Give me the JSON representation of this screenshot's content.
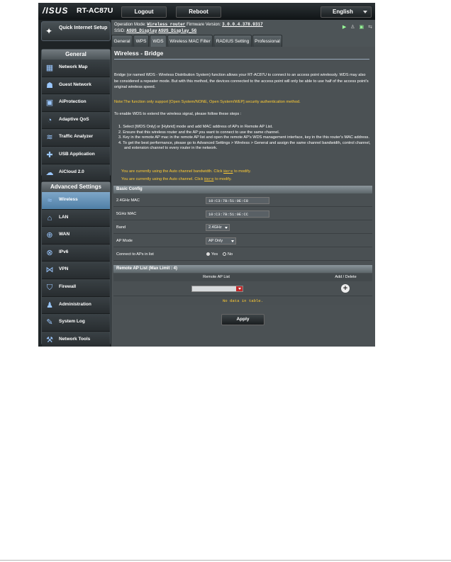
{
  "header": {
    "brand": "/ISUS",
    "model": "RT-AC87U",
    "logout": "Logout",
    "reboot": "Reboot",
    "language": "English"
  },
  "status": {
    "op_mode_label": "Operation Mode:",
    "op_mode": "Wireless router",
    "fw_label": "Firmware Version:",
    "fw": "3.0.0.4.378.9317",
    "ssid_label": "SSID:",
    "ssid_1": "ASUS_Display",
    "ssid_2": "ASUS_Display_5G"
  },
  "sidebar": {
    "quick_setup": "Quick Internet Setup",
    "general_title": "General",
    "general_items": [
      {
        "label": "Network Map",
        "icon": "network-map-icon",
        "glyph": "▦"
      },
      {
        "label": "Guest Network",
        "icon": "guest-network-icon",
        "glyph": "☗"
      },
      {
        "label": "AiProtection",
        "icon": "lock-icon",
        "glyph": "▣"
      },
      {
        "label": "Adaptive QoS",
        "icon": "gauge-icon",
        "glyph": "◔"
      },
      {
        "label": "Traffic Analyzer",
        "icon": "chart-icon",
        "glyph": "≋"
      },
      {
        "label": "USB Application",
        "icon": "puzzle-icon",
        "glyph": "✚"
      },
      {
        "label": "AiCloud 2.0",
        "icon": "cloud-icon",
        "glyph": "☁"
      }
    ],
    "advanced_title": "Advanced Settings",
    "advanced_items": [
      {
        "label": "Wireless",
        "icon": "wireless-icon",
        "glyph": "≈",
        "active": true
      },
      {
        "label": "LAN",
        "icon": "house-icon",
        "glyph": "⌂"
      },
      {
        "label": "WAN",
        "icon": "globe-icon",
        "glyph": "⊕"
      },
      {
        "label": "IPv6",
        "icon": "ipv6-icon",
        "glyph": "⊗"
      },
      {
        "label": "VPN",
        "icon": "vpn-icon",
        "glyph": "⋈"
      },
      {
        "label": "Firewall",
        "icon": "shield-icon",
        "glyph": "⛉"
      },
      {
        "label": "Administration",
        "icon": "admin-icon",
        "glyph": "♟"
      },
      {
        "label": "System Log",
        "icon": "log-icon",
        "glyph": "✎"
      },
      {
        "label": "Network Tools",
        "icon": "tools-icon",
        "glyph": "⚒"
      }
    ]
  },
  "tabs": [
    "General",
    "WPS",
    "WDS",
    "Wireless MAC Filter",
    "RADIUS Setting",
    "Professional"
  ],
  "page": {
    "title": "Wireless - Bridge",
    "intro": "Bridge (or named WDS - Wireless Distribution System) function allows your RT-AC87U to connect to an access point wirelessly. WDS may also be considered a repeater mode. But with this method, the devices connected to the access point will only be able to use half of the access point's original wireless speed.",
    "note": "Note:The function only support [Open System/NONE, Open System/WEP] security authentication method.",
    "enable": "To enable WDS to extend the wireless signal, please follow these steps :",
    "steps": [
      "1.  Select [WDS Only] or [Hybrid] mode and add MAC address of APs in Remote AP List.",
      "2.  Ensure that this wireless router and the AP you want to connect to use the same channel.",
      "3.  Key in the remote AP mac in the remote AP list and open the remote AP's WDS management interface, key in the this router's MAC address.",
      "4.  To get the best performance, please go to Advanced Settings > Wireless > General and assign the same channel bandwidth, control channel, and extension channel to every router in the network."
    ],
    "warn1_pre": "You are currently using the Auto channel bandwidth. Click ",
    "warn2_pre": "You are currently using the Auto channel. Click ",
    "here": "Here",
    "warn_post": " to modify."
  },
  "basic": {
    "title": "Basic Config",
    "mac24_label": "2.4GHz MAC",
    "mac24": "10:C3:7B:51:0E:C8",
    "mac5_label": "5GHz MAC",
    "mac5": "10:C3:7B:51:0E:CC",
    "band_label": "Band",
    "band": "2.4GHz",
    "apmode_label": "AP Mode",
    "apmode": "AP Only",
    "connect_label": "Connect to APs in list",
    "yes": "Yes",
    "no": "No",
    "connect_value": "Yes"
  },
  "remote": {
    "title": "Remote AP List (Max Limit : 4)",
    "col1": "Remote AP List",
    "col2": "Add / Delete",
    "empty": "No data in table."
  },
  "apply": "Apply"
}
